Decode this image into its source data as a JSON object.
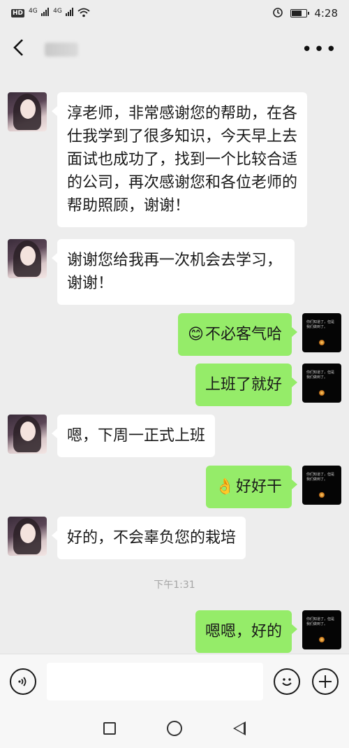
{
  "status_bar": {
    "hd": "HD",
    "network1": "4G",
    "network2": "4G",
    "time": "4:28"
  },
  "nav": {
    "back_icon": "chevron-left-icon",
    "more_label": "•••"
  },
  "hint_text": "",
  "messages": [
    {
      "side": "left",
      "text": "淳老师，非常感谢您的帮助，在各仕我学到了很多知识，今天早上去面试也成功了，找到一个比较合适的公司，再次感谢您和各位老师的帮助照顾，谢谢！"
    },
    {
      "side": "left",
      "text": "谢谢您给我再一次机会去学习，谢谢！"
    },
    {
      "side": "right",
      "emoji": "😊",
      "text": "不必客气哈"
    },
    {
      "side": "right",
      "text": "上班了就好"
    },
    {
      "side": "left",
      "text": "嗯，下周一正式上班"
    },
    {
      "side": "right",
      "emoji": "👌",
      "text": "好好干"
    },
    {
      "side": "left",
      "text": "好的，不会辜负您的栽培"
    },
    {
      "side": "right",
      "text": "嗯嗯，好的"
    }
  ],
  "timestamp": "下午1:31",
  "avatar_right_text": "你们知道了，但是我们做到了。",
  "input": {
    "voice_icon": "voice-icon",
    "voice_glyph": "◁)",
    "emoji_icon": "emoji-icon",
    "emoji_glyph": "☺",
    "plus_icon": "plus-icon",
    "plus_glyph": "+"
  },
  "colors": {
    "background": "#ededed",
    "bubble_self": "#95ec69",
    "bubble_other": "#ffffff"
  }
}
